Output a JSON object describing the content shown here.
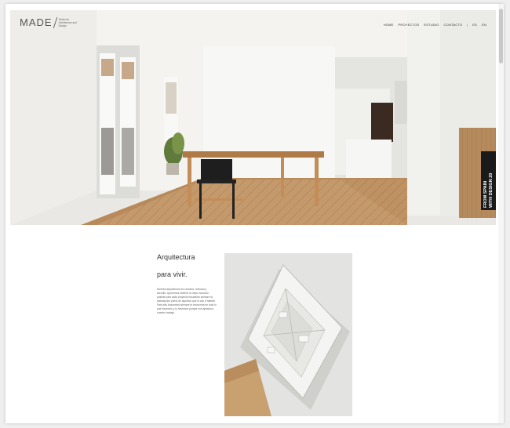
{
  "logo": {
    "wordmark": "MADE",
    "tagline": "Studio for Architecture and Design"
  },
  "nav": {
    "items": [
      {
        "label": "HOME"
      },
      {
        "label": "PROYECTOS"
      },
      {
        "label": "ESTUDIO"
      },
      {
        "label": "CONTACTO"
      }
    ],
    "separator": "|",
    "languages": [
      {
        "label": "ES"
      },
      {
        "label": "EN"
      }
    ]
  },
  "hero": {
    "badge_line1": "FROM SPAIN",
    "badge_line2": "WITH DESIGN 20"
  },
  "content": {
    "title": "Arquitectura",
    "subtitle": "para vivir.",
    "body": "Nuestra arquitectura es cercana, humana y sencilla. Queremos obtener la mejor solución posible para cada proyecto buscando siempre la satisfacción plena de aquellos que lo van a habitar. Para ello buscamos siempre la economía en todo lo que hacemos y lo hacemos porque nos apasiona nuestro trabajo."
  },
  "colors": {
    "text": "#333333",
    "wood": "#b58a5c",
    "wall": "#f2f1ee"
  }
}
